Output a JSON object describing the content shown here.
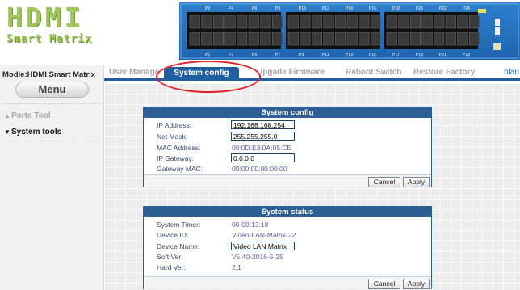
{
  "logo": {
    "line1": "HDMI",
    "line2": "Smart Matrix"
  },
  "device_image": {
    "top_port_labels": [
      "P2",
      "P4",
      "P6",
      "P8",
      "P10",
      "P12",
      "P14",
      "P16",
      "P18",
      "P20",
      "P22",
      "P24"
    ],
    "bottom_port_labels": [
      "P1",
      "P3",
      "P5",
      "P7",
      "P9",
      "P11",
      "P13",
      "P15",
      "P17",
      "P19",
      "P21",
      "P23"
    ]
  },
  "sidebar": {
    "model": "Modle:HDMI Smart Matrix",
    "menu_label": "Menu",
    "items": [
      {
        "label": "Ports Tool",
        "arrow": "▲",
        "active": false
      },
      {
        "label": "System tools",
        "arrow": "▼",
        "active": true
      }
    ]
  },
  "tabs": [
    {
      "label": "User Manage",
      "active": false
    },
    {
      "label": "System config",
      "active": true
    },
    {
      "label": "Upgade Firmware",
      "active": false
    },
    {
      "label": "Reboot Switch",
      "active": false
    },
    {
      "label": "Restore Factory",
      "active": false
    },
    {
      "label": "blan",
      "active": false
    }
  ],
  "system_config": {
    "title": "System config",
    "ip_address": {
      "label": "IP Address:",
      "value": "192.168.168.254"
    },
    "net_mask": {
      "label": "Net Mask:",
      "value": "255.255.255.0"
    },
    "mac_address": {
      "label": "MAC Address:",
      "value": "00:0D:E3:0A:05:CE"
    },
    "ip_gateway": {
      "label": "IP Gateway:",
      "value": "0.0.0.0"
    },
    "gateway_mac": {
      "label": "Gateway MAC:",
      "value": "00:00:00:00:00:00"
    },
    "cancel_label": "Cancel",
    "apply_label": "Apply"
  },
  "system_status": {
    "title": "System status",
    "system_timer": {
      "label": "System Timer:",
      "value": "00-00:13:18"
    },
    "device_id": {
      "label": "Device ID:",
      "value": "Video-LAN-Matrix-22"
    },
    "device_name": {
      "label": "Device Name:",
      "value": "Video LAN Matrix"
    },
    "soft_ver": {
      "label": "Soft Ver:",
      "value": "V5.40-2016-5-25"
    },
    "hard_ver": {
      "label": "Hard Ver:",
      "value": "2.1"
    },
    "cancel_label": "Cancel",
    "apply_label": "Apply"
  },
  "colors": {
    "accent_blue": "#1f5ea0",
    "panel_blue": "#2d5f94",
    "logo_green": "#9fc65b",
    "annotation_red": "#e32026"
  }
}
